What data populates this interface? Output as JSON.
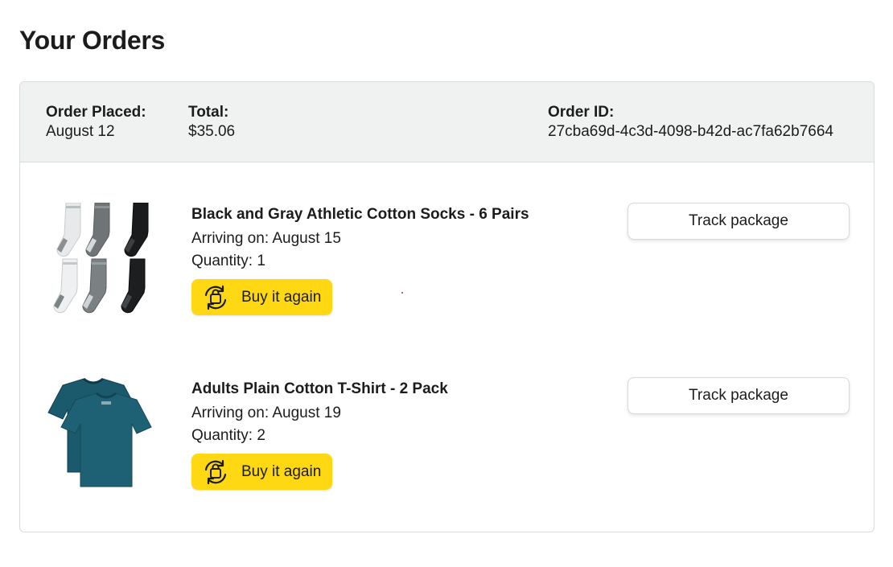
{
  "page": {
    "title": "Your Orders"
  },
  "order": {
    "placed_label": "Order Placed:",
    "placed_value": "August 12",
    "total_label": "Total:",
    "total_value": "$35.06",
    "id_label": "Order ID:",
    "id_value": "27cba69d-4c3d-4098-b42d-ac7fa62b7664",
    "items": [
      {
        "name": "Black and Gray Athletic Cotton Socks - 6 Pairs",
        "arrival": "Arriving on: August 15",
        "quantity": "Quantity: 1",
        "buy_again_label": "Buy it again",
        "track_label": "Track package",
        "image": "athletic-socks-image"
      },
      {
        "name": "Adults Plain Cotton T-Shirt - 2 Pack",
        "arrival": "Arriving on: August 19",
        "quantity": "Quantity: 2",
        "buy_again_label": "Buy it again",
        "track_label": "Track package",
        "image": "teal-tshirt-image"
      }
    ]
  },
  "colors": {
    "buy_again_bg": "#ffd814",
    "header_bg": "#f0f2f2",
    "border": "#d9dcdc",
    "tshirt": "#1f6174"
  },
  "icons": {
    "buy_again": "buy-again-icon"
  }
}
